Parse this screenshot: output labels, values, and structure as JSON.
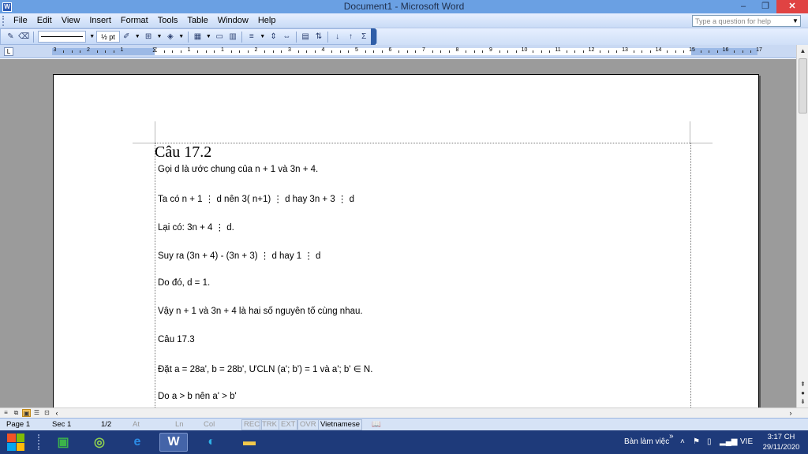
{
  "window": {
    "title": "Document1 - Microsoft Word",
    "minimize": "–",
    "restore": "❐",
    "close": "✕"
  },
  "menu": {
    "items": [
      "File",
      "Edit",
      "View",
      "Insert",
      "Format",
      "Tools",
      "Table",
      "Window",
      "Help"
    ],
    "help_placeholder": "Type a question for help"
  },
  "toolbar": {
    "line_weight": "½ pt",
    "sigma": "Σ"
  },
  "ruler": {
    "numbers": [
      "3",
      "2",
      "1",
      "1",
      "1",
      "2",
      "3",
      "4",
      "5",
      "6",
      "7",
      "8",
      "9",
      "10",
      "11",
      "12",
      "13",
      "14",
      "15",
      "16",
      "17"
    ]
  },
  "document": {
    "heading": "Câu 17.2",
    "paragraphs": [
      "Gọi d là ước chung của n + 1 và 3n + 4.",
      "Ta có n + 1 ⋮ d nên 3( n+1) ⋮ d hay 3n + 3 ⋮ d",
      "Lại có: 3n + 4 ⋮ d.",
      "Suy ra (3n + 4) - (3n + 3) ⋮ d hay 1 ⋮ d",
      "Do đó, d = 1.",
      "Vậy n + 1 và 3n + 4 là hai số nguyên tố cùng nhau.",
      "Câu 17.3",
      "Đặt a = 28a', b = 28b', ƯCLN (a'; b') = 1 và a'; b' ∈ N.",
      "Do a > b nên a' > b'"
    ]
  },
  "status": {
    "page": "Page 1",
    "sec": "Sec 1",
    "pages": "1/2",
    "at": "At",
    "ln": "Ln",
    "col": "Col",
    "rec": "REC",
    "trk": "TRK",
    "ext": "EXT",
    "ovr": "OVR",
    "language": "Vietnamese"
  },
  "taskbar": {
    "desktop_label": "Bàn làm việc",
    "chevron": "»",
    "lang": "VIE",
    "time": "3:17 CH",
    "date": "29/11/2020"
  },
  "colors": {
    "titlebar": "#6aa0e3",
    "taskbar": "#1e3a7a",
    "close": "#e04343"
  }
}
